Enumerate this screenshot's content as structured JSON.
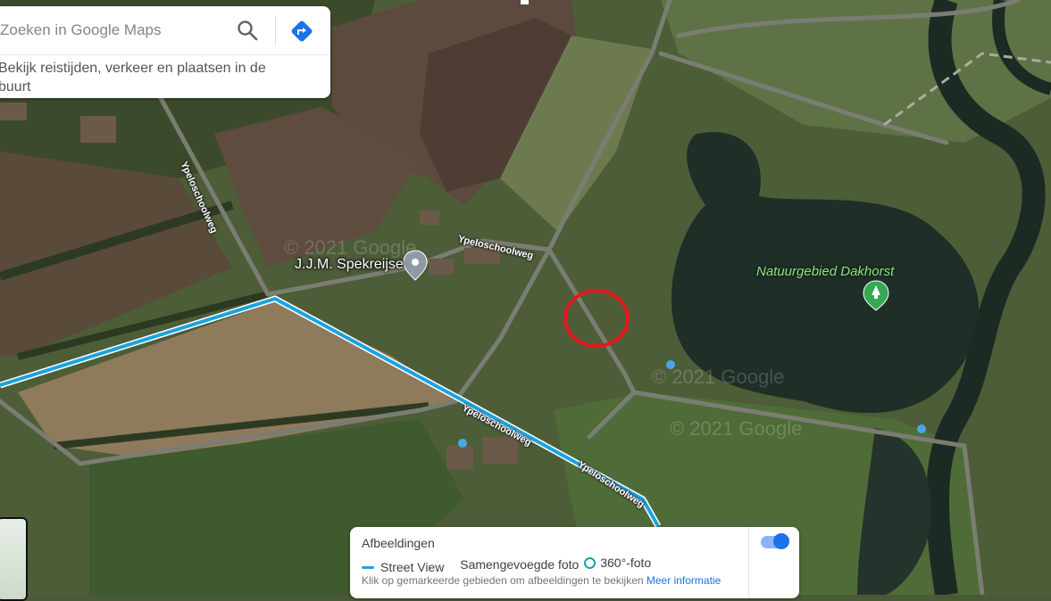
{
  "search": {
    "placeholder": "Zoeken in Google Maps",
    "hint": "Bekijk reistijden, verkeer en plaatsen in de buurt"
  },
  "map": {
    "road_labels": {
      "vertical": "Ypeloschoolweg",
      "north": "Ypeloschoolweg",
      "south_1": "Ypeloschoolweg",
      "south_2": "Ypeloschoolweg"
    },
    "place_label": "J.J.M. Spekreijse",
    "park_label": "Natuurgebied Dakhorst",
    "watermark": "© 2021 Google",
    "colors": {
      "street_view_line": "#1aa3e0",
      "marker_circle": "#e8171c",
      "park_icon": "#34a853"
    }
  },
  "layer_panel": {
    "title": "Afbeeldingen",
    "legend": {
      "street_view": "Street View",
      "merged_photo": "Samengevoegde foto",
      "photo_360": "360°-foto"
    },
    "info": "Klik op gemarkeerde gebieden om afbeeldingen te bekijken",
    "more_link": "Meer informatie",
    "toggle_on": true
  }
}
